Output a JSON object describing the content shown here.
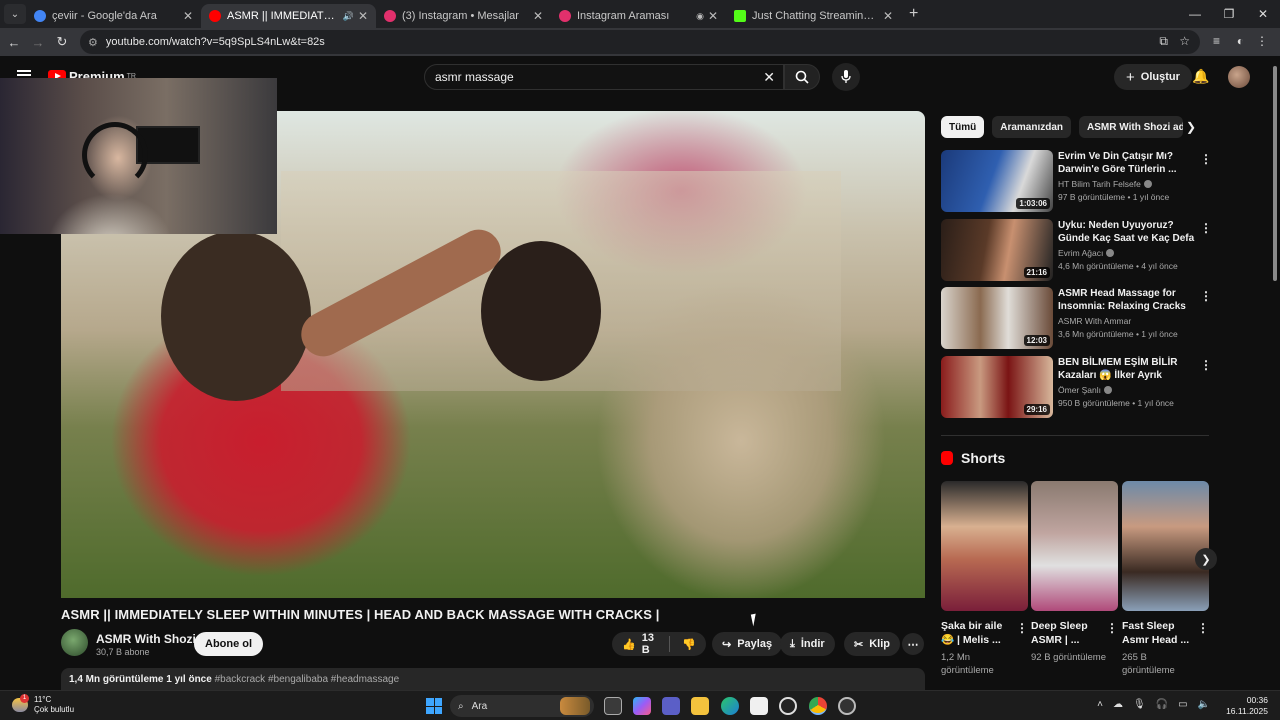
{
  "browser": {
    "tabs": [
      {
        "title": "çeviir - Google'da Ara",
        "color": "#4285f4",
        "active": false
      },
      {
        "title": "ASMR || IMMEDIATELY SLEE",
        "color": "#ff0000",
        "active": true
      },
      {
        "title": "(3) Instagram • Mesajlar",
        "color": "#e1306c",
        "active": false
      },
      {
        "title": "Instagram Araması",
        "color": "#e1306c",
        "active": false
      },
      {
        "title": "Just Chatting Streaming - Live",
        "color": "#53fc18",
        "active": false
      }
    ],
    "url": "youtube.com/watch?v=5q9SpLS4nLw&t=82s"
  },
  "header": {
    "logo_text": "Premium",
    "logo_region": "TR",
    "search_value": "asmr massage",
    "create_label": "Oluştur"
  },
  "video": {
    "title": "ASMR || IMMEDIATELY SLEEP WITHIN MINUTES | HEAD AND BACK MASSAGE WITH CRACKS |",
    "channel": "ASMR With Shozi",
    "subscribers": "30,7 B abone",
    "subscribe_label": "Abone ol",
    "likes": "13 B",
    "share_label": "Paylaş",
    "download_label": "İndir",
    "clip_label": "Klip",
    "views_date": "1,4 Mn görüntüleme  1 yıl önce",
    "hashtags": "#backcrack #bengalibaba #headmassage"
  },
  "chips": [
    "Tümü",
    "Aramanızdan",
    "ASMR With Shozi adlı yü"
  ],
  "recommendations": [
    {
      "title": "Evrim Ve Din Çatışır Mı? Darwin'e Göre Türlerin ...",
      "channel": "HT Bilim Tarih Felsefe",
      "meta": "97 B görüntüleme • 1 yıl önce",
      "duration": "1:03:06",
      "thumb_color": "#1b3a7a"
    },
    {
      "title": "Uyku: Neden Uyuyoruz? Günde Kaç Saat ve Kaç Defa ...",
      "channel": "Evrim Ağacı",
      "meta": "4,6 Mn görüntüleme • 4 yıl önce",
      "duration": "21:16",
      "thumb_color": "#5a3a28"
    },
    {
      "title": "ASMR Head Massage for Insomnia: Relaxing Cracks an...",
      "channel": "ASMR With Ammar",
      "meta": "3,6 Mn görüntüleme • 1 yıl önce",
      "duration": "12:03",
      "thumb_color": "#8a6a50"
    },
    {
      "title": "BEN BİLMEM EŞİM BİLİR Kazaları 😱 İlker Ayrık Anlatıyor",
      "channel": "Ömer Şanlı",
      "meta": "950 B görüntüleme • 1 yıl önce",
      "duration": "29:16",
      "thumb_color": "#8a1c1c"
    }
  ],
  "shorts_heading": "Shorts",
  "shorts": [
    {
      "title": "Şaka bir aile 😂 | Melis ...",
      "views": "1,2 Mn görüntüleme",
      "thumb_color": "#b86a52"
    },
    {
      "title": "Deep Sleep ASMR | ...",
      "views": "92 B görüntüleme",
      "thumb_color": "#c0a5a0"
    },
    {
      "title": "Fast Sleep Asmr Head ...",
      "views": "265 B görüntüleme",
      "thumb_color": "#6d8aa8"
    }
  ],
  "taskbar": {
    "temperature": "11°C",
    "weather_text": "Çok bulutlu",
    "weather_badge": "1",
    "search_label": "Ara",
    "time": "00:36",
    "date": "16.11.2025"
  }
}
